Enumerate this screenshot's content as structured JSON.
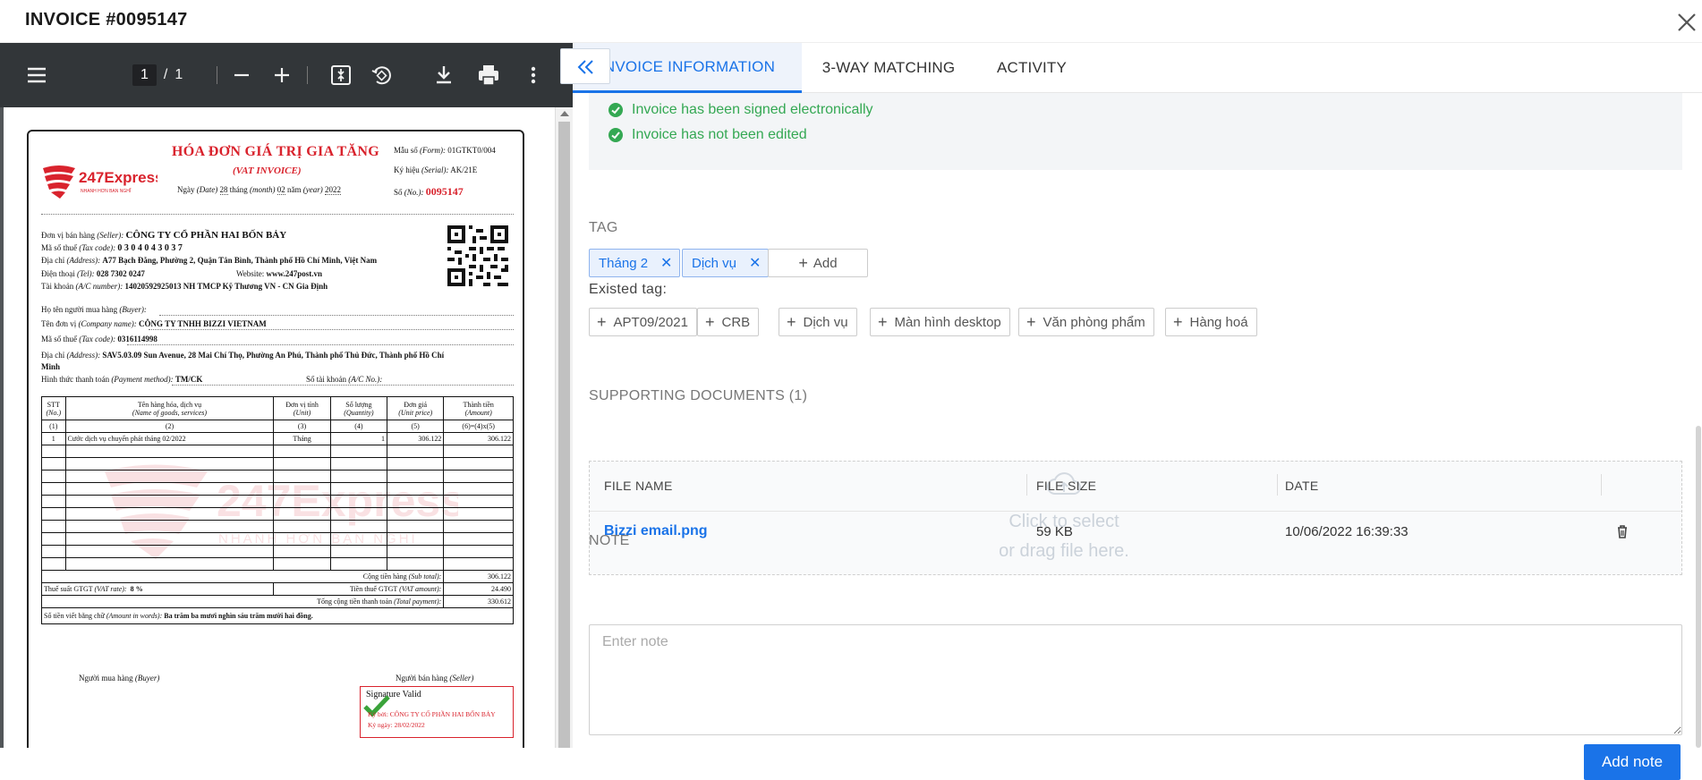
{
  "header": {
    "title": "INVOICE #0095147"
  },
  "viewer": {
    "page_current": "1",
    "page_separator": "/",
    "page_total": "1"
  },
  "invoice_doc": {
    "title": "HÓA ĐƠN GIÁ TRỊ GIA TĂNG",
    "subtitle": "(VAT INVOICE)",
    "logo_text": "247Express",
    "logo_tagline": "NHANH HƠN BẠN NGHĨ",
    "date_line_a": "Ngày",
    "date_line_b": "(Date)",
    "date_day": "28",
    "date_line_c": "tháng",
    "date_line_d": "(month)",
    "date_month": "02",
    "date_line_e": "năm",
    "date_line_f": "(year)",
    "date_year": "2022",
    "form_label": "Mẫu số",
    "form_en": "(Form):",
    "form_value": "01GTKT0/004",
    "serial_label": "Ký hiệu",
    "serial_en": "(Serial):",
    "serial_value": "AK/21E",
    "no_label": "Số",
    "no_en": "(No.):",
    "no_value": "0095147",
    "seller_label": "Đơn vị bán hàng",
    "seller_en": "(Seller):",
    "seller_value": "CÔNG TY CỔ PHẦN HAI BỐN BẢY",
    "tax_label": "Mã số thuế",
    "tax_en": "(Tax code):",
    "tax_value": "0 3 0 4 0 4 3 0 3 7",
    "addr_label": "Địa chỉ",
    "addr_en": "(Address):",
    "addr_value": "A77 Bạch Đằng, Phường 2, Quận Tân Bình, Thành phố Hồ Chí Minh, Việt Nam",
    "tel_label": "Điện thoại",
    "tel_en": "(Tel):",
    "tel_value": "028 7302 0247",
    "web_label": "Website:",
    "web_value": "www.247post.vn",
    "acc_label": "Tài khoản",
    "acc_en": "(A/C number):",
    "acc_value": "14020592925013   NH TMCP Kỹ Thương VN - CN Gia Định",
    "buyer_label": "Họ tên người mua hàng",
    "buyer_en": "(Buyer):",
    "company_label": "Tên đơn vị",
    "company_en": "(Company name):",
    "company_value": "CÔNG TY TNHH BIZZI VIETNAM",
    "btax_label": "Mã số thuế",
    "btax_en": "(Tax code):",
    "btax_value": "0316114998",
    "baddr_label": "Địa chỉ",
    "baddr_en": "(Address):",
    "baddr_value": "SAV5.03.09 Sun Avenue, 28 Mai Chí Thọ, Phường An Phú, Thành phố Thủ Đức, Thành phố Hồ Chí",
    "baddr_value2": "Minh",
    "pay_label": "Hình thức thanh toán",
    "pay_en": "(Payment method):",
    "pay_value": "TM/CK",
    "accno_label": "Số tài khoản",
    "accno_en": "(A/C No.):",
    "table_headers": [
      {
        "vn": "STT",
        "en": "(No.)"
      },
      {
        "vn": "Tên hàng hóa, dịch vụ",
        "en": "(Name of goods, services)"
      },
      {
        "vn": "Đơn vị tính",
        "en": "(Unit)"
      },
      {
        "vn": "Số lượng",
        "en": "(Quantity)"
      },
      {
        "vn": "Đơn giá",
        "en": "(Unit price)"
      },
      {
        "vn": "Thành tiền",
        "en": "(Amount)"
      }
    ],
    "table_index": [
      "(1)",
      "(2)",
      "(3)",
      "(4)",
      "(5)",
      "(6)=(4)x(5)"
    ],
    "row1": [
      "1",
      "Cước dịch vụ chuyển phát tháng 02/2022",
      "Tháng",
      "1",
      "306.122",
      "306.122"
    ],
    "subtotal_label": "Cộng tiền hàng",
    "subtotal_en": "(Sub total):",
    "subtotal_value": "306.122",
    "vatrate_label": "Thuế suất GTGT",
    "vatrate_en": "(VAT rate):",
    "vatrate_value": "8 %",
    "vatamt_label": "Tiền thuế GTGT",
    "vatamt_en": "(VAT amount):",
    "vatamt_value": "24.490",
    "total_label": "Tổng cộng tiền thanh toán",
    "total_en": "(Total payment):",
    "total_value": "330.612",
    "words_label": "Số tiền viết bằng chữ",
    "words_en": "(Amount in words):",
    "words_value": "Ba trăm ba mươi nghìn sáu trăm mười hai đồng.",
    "buyer_sign_label": "Người mua hàng",
    "buyer_sign_en": "(Buyer)",
    "seller_sign_label": "Người bán hàng",
    "seller_sign_en": "(Seller)",
    "sig_valid": "Signature Valid",
    "sig_by": "Ký bởi: CÔNG TY CỔ PHẦN HAI BỐN BẢY",
    "sig_date": "Ký ngày: 28/02/2022",
    "watermark_text": "247Express",
    "watermark_tag": "NHANH HƠN BẠN NGHĨ"
  },
  "tabs": [
    {
      "label": "INVOICE INFORMATION"
    },
    {
      "label": "3-WAY MATCHING"
    },
    {
      "label": "ACTIVITY"
    }
  ],
  "validation": [
    {
      "text": "Invoice has been signed electronically"
    },
    {
      "text": "Invoice has not been edited"
    }
  ],
  "tag_section": {
    "label": "TAG",
    "tags": [
      {
        "label": "Tháng 2"
      },
      {
        "label": "Dịch vụ"
      }
    ],
    "add_label": "Add",
    "existed_label": "Existed tag:",
    "existed": [
      {
        "label": "APT09/2021"
      },
      {
        "label": "CRB"
      },
      {
        "label": "Dịch vụ"
      },
      {
        "label": "Màn hình desktop"
      },
      {
        "label": "Văn phòng phẩm"
      },
      {
        "label": "Hàng hoá"
      }
    ]
  },
  "docs": {
    "label": "SUPPORTING DOCUMENTS (1)",
    "col_name": "FILE NAME",
    "col_size": "FILE SIZE",
    "col_date": "DATE",
    "dropzone_line1": "Click to select",
    "dropzone_line2": "or drag file here.",
    "files": [
      {
        "name": "Bizzi email.png",
        "size": "59 KB",
        "date": "10/06/2022 16:39:33"
      }
    ]
  },
  "note": {
    "label": "NOTE",
    "placeholder": "Enter note",
    "button": "Add note"
  },
  "colors": {
    "accent": "#1a73e8",
    "success": "#34a853",
    "invoice_red": "#d9232d"
  }
}
